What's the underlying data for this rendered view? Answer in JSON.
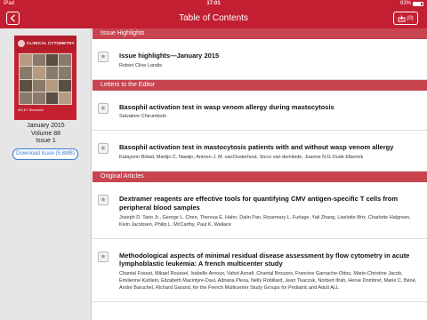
{
  "status_bar": {
    "carrier": "iPad",
    "time": "17:01",
    "battery_text": "83%",
    "battery_level": 0.83
  },
  "nav": {
    "title": "Table of Contents",
    "cart_count": "(0)"
  },
  "sidebar": {
    "cover_title": "CLINICAL CYTOMETRY",
    "cover_publisher": "WILEY Blackwell",
    "issue_date": "January 2015",
    "volume": "Volume 88",
    "issue": "Issue 1",
    "download_label": "Download Issue (5.8MB)"
  },
  "sections": [
    {
      "header": "Issue Highlights",
      "articles": [
        {
          "title": "Issue highlights—January 2015",
          "authors": "Robert Clive Landis"
        }
      ]
    },
    {
      "header": "Letters to the Editor",
      "articles": [
        {
          "title": "Basophil activation test in wasp venom allergy during mastocytosis",
          "authors": "Salvatore Chirumbolo"
        },
        {
          "title": "Basophil activation test in mastocytosis patients with and without wasp venom allergy",
          "authors": "Katayoon Bidad, Martijn C. Nawijn, Antoon J. M. vanOosterhout, Sicco van derHeide, Joanne N.G Oude Elberink"
        }
      ]
    },
    {
      "header": "Original Articles",
      "articles": [
        {
          "title": "Dextramer reagents are effective tools for quantifying CMV antigen-specific T cells from peripheral blood samples",
          "authors": "Joseph D. Tario Jr., George L. Chen, Theresa E. Hahn, Dalin Pan, Rosemary L. Furlage, Yali Zhang, Liselotte Brix, Charlotte Halgreen, Kivin Jacobsen, Philip L. McCarthy, Paul K. Wallace"
        },
        {
          "title": "Methodological aspects of minimal residual disease assessment by flow cytometry in acute lymphoblastic leukemia: A french multicenter study",
          "authors": "Chantal Fossat, Mikael Roussel, Isabelle Arnoux, Vahid Asnafi, Chantal Brouzes, Francine Garnache-Ottou, Marie-Christine Jacob, Emilienne Kuhlein, Elizabeth Macintyre-Davi, Adriana Plesa, Nelly Robillard, Jean Tkaczuk, Norbert Ifrah, Herve Dombret, Marie C. Béné, Andre Baruchel, Richard Garand, for the French Multicenter Study Groups for Pediatric and Adult ALL"
        }
      ]
    }
  ]
}
